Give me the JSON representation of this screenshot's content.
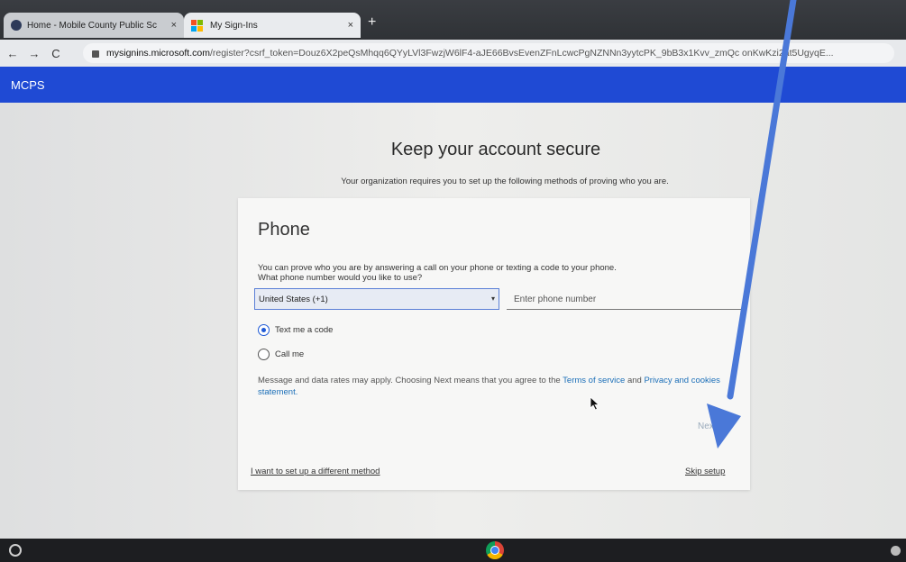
{
  "browser": {
    "tabs": [
      {
        "title": "Home - Mobile County Public Sc",
        "close": "×"
      },
      {
        "title": "My Sign-Ins",
        "close": "×"
      }
    ],
    "new_tab": "+",
    "nav": {
      "back": "←",
      "forward": "→",
      "reload": "C"
    },
    "url_host": "mysignins.microsoft.com",
    "url_rest": "/register?csrf_token=Douz6X2peQsMhqq6QYyLVl3FwzjW6lF4-aJE66BvsEvenZFnLcwcPgNZNNn3yytcPK_9bB3x1Kvv_zmQc   onKwKzi2at5UgyqE..."
  },
  "header": {
    "org_name": "MCPS"
  },
  "main": {
    "title": "Keep your account secure",
    "subtitle": "Your organization requires you to set up the following methods of proving who you are.",
    "card": {
      "title": "Phone",
      "description_line1": "You can prove who you are by answering a call on your phone or texting a code to your phone.",
      "description_line2": "What phone number would you like to use?",
      "country_select": "United States (+1)",
      "phone_placeholder": "Enter phone number",
      "radio_text": "Text me a code",
      "radio_call": "Call me",
      "notice_prefix": "Message and data rates may apply. Choosing Next means that you agree to the ",
      "terms_link": "Terms of service",
      "notice_and": " and ",
      "privacy_link": "Privacy and cookies statement.",
      "next_label": "Next",
      "different_method": "I want to set up a different method",
      "skip_setup": "Skip setup"
    }
  },
  "colors": {
    "brand_bar": "#1f4ad4",
    "link": "#1c6fb8",
    "annotation_arrow": "#4a78d8"
  }
}
